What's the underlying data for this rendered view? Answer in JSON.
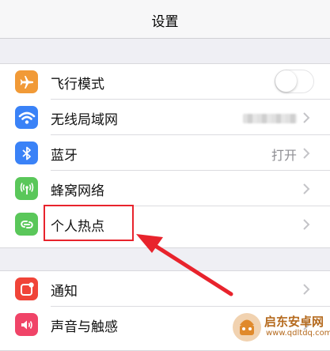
{
  "nav": {
    "title": "设置"
  },
  "group1": [
    {
      "label": "飞行模式",
      "icon": "airplane-icon",
      "color": "#f19a37",
      "accessory": "toggle",
      "toggle_on": false
    },
    {
      "label": "无线局域网",
      "icon": "wifi-icon",
      "color": "#3a82f7",
      "accessory": "blurred-chevron"
    },
    {
      "label": "蓝牙",
      "icon": "bluetooth-icon",
      "color": "#3a82f7",
      "accessory": "detail-chevron",
      "detail": "打开"
    },
    {
      "label": "蜂窝网络",
      "icon": "cellular-icon",
      "color": "#5ac75a",
      "accessory": "chevron"
    },
    {
      "label": "个人热点",
      "icon": "hotspot-icon",
      "color": "#5ac75a",
      "accessory": "chevron"
    }
  ],
  "group2": [
    {
      "label": "通知",
      "icon": "notification-icon",
      "color": "#f04438",
      "accessory": "chevron"
    },
    {
      "label": "声音与触感",
      "icon": "speaker-icon",
      "color": "#f04468",
      "accessory": "chevron"
    }
  ],
  "annotation": {
    "highlight_color": "#e8232c"
  },
  "watermark": {
    "line1": "启东安卓网",
    "line2": "www.qdltdq.com",
    "color": "#b56a1e"
  }
}
